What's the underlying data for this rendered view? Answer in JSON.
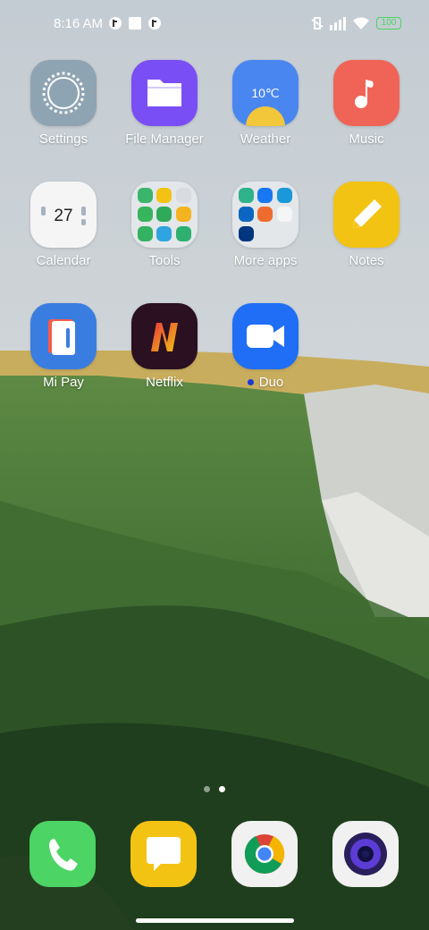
{
  "status_bar": {
    "time": "8:16 AM",
    "battery": "100",
    "icons": [
      "app-notification-icon",
      "square-icon",
      "app-notification-icon-2",
      "vibrate-icon",
      "signal-icon",
      "wifi-icon",
      "battery-icon"
    ]
  },
  "apps": [
    {
      "label": "Settings",
      "icon": "settings-gear-icon",
      "color": "#8fa4b3"
    },
    {
      "label": "File Manager",
      "icon": "folder-icon",
      "color": "#7a4ef5"
    },
    {
      "label": "Weather",
      "icon": "weather-sun-icon",
      "color": "#4a86f0",
      "temp": "10℃"
    },
    {
      "label": "Music",
      "icon": "music-note-icon",
      "color": "#f06457"
    },
    {
      "label": "Calendar",
      "icon": "calendar-icon",
      "color": "#f5f5f5",
      "day": "27"
    },
    {
      "label": "Tools",
      "icon": "tools-folder-icon"
    },
    {
      "label": "More apps",
      "icon": "more-apps-folder-icon"
    },
    {
      "label": "Notes",
      "icon": "pencil-icon",
      "color": "#f3c314"
    },
    {
      "label": "Mi Pay",
      "icon": "mi-pay-card-icon",
      "color": "#3a7de0"
    },
    {
      "label": "Netflix",
      "icon": "netflix-n-icon",
      "color": "#2a1020"
    },
    {
      "label": "Duo",
      "icon": "video-camera-icon",
      "color": "#1f6ef5"
    }
  ],
  "page_indicator": {
    "pages": 2,
    "active": 1
  },
  "dock": [
    {
      "name": "phone",
      "icon": "phone-icon",
      "color": "#4cd464"
    },
    {
      "name": "messages",
      "icon": "message-bubble-icon",
      "color": "#f3c314"
    },
    {
      "name": "chrome",
      "icon": "chrome-icon",
      "color": "#f1f1f1"
    },
    {
      "name": "camera",
      "icon": "camera-lens-icon",
      "color": "#f1f1f1"
    }
  ]
}
